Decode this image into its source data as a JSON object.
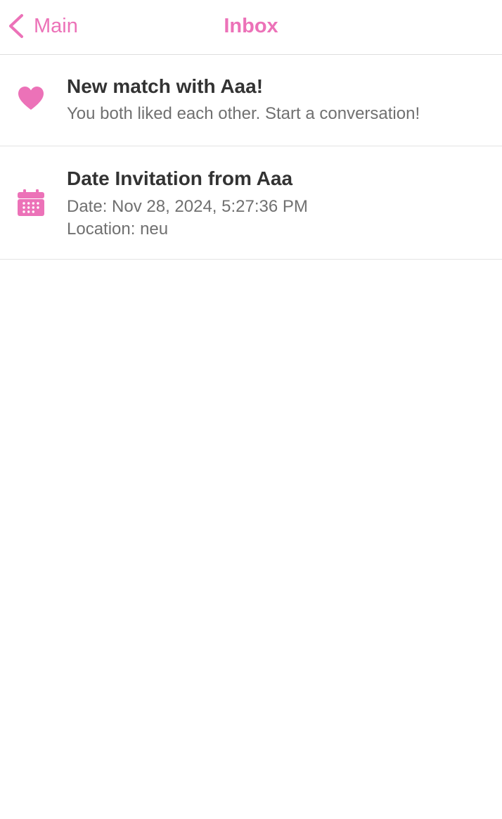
{
  "colors": {
    "accent": "#ec72b8",
    "title_text": "#333333",
    "body_text": "#707070",
    "divider": "#e4e4e4"
  },
  "navbar": {
    "back_icon": "chevron-left-icon",
    "back_label": "Main",
    "title": "Inbox"
  },
  "inbox": {
    "items": [
      {
        "icon": "heart-icon",
        "title": "New match with Aaa!",
        "body": "You both liked each other. Start a conversation!"
      },
      {
        "icon": "calendar-icon",
        "title": "Date Invitation from Aaa",
        "date_line": "Date: Nov 28, 2024, 5:27:36 PM",
        "location_line": "Location: neu"
      }
    ]
  }
}
